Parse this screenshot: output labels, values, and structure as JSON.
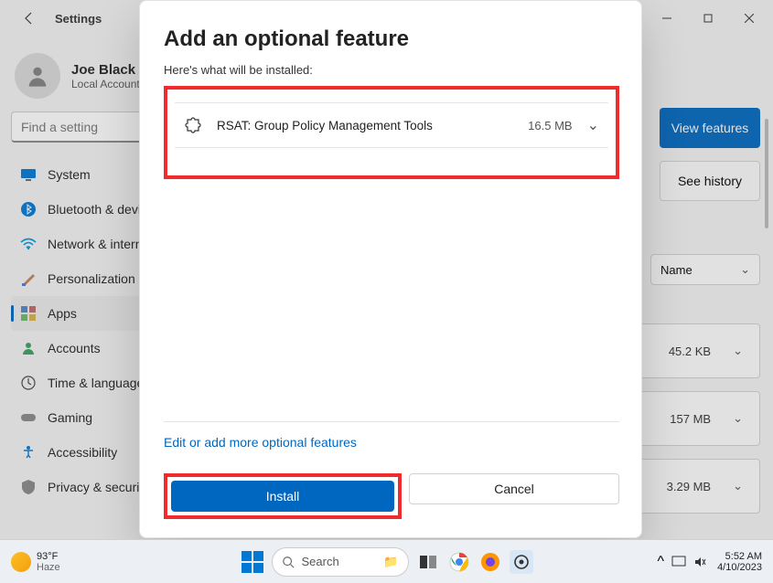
{
  "window": {
    "title": "Settings"
  },
  "profile": {
    "name": "Joe Black",
    "account_type": "Local Account"
  },
  "search": {
    "placeholder": "Find a setting"
  },
  "sidebar": {
    "items": [
      {
        "label": "System"
      },
      {
        "label": "Bluetooth & devices"
      },
      {
        "label": "Network & internet"
      },
      {
        "label": "Personalization"
      },
      {
        "label": "Apps"
      },
      {
        "label": "Accounts"
      },
      {
        "label": "Time & language"
      },
      {
        "label": "Gaming"
      },
      {
        "label": "Accessibility"
      },
      {
        "label": "Privacy & security"
      }
    ]
  },
  "page": {
    "view_features_btn": "View features",
    "see_history_btn": "See history",
    "sort_label": "Name",
    "rows": [
      {
        "size": "45.2 KB"
      },
      {
        "size": "157 MB"
      },
      {
        "size": "3.29 MB"
      }
    ]
  },
  "modal": {
    "title": "Add an optional feature",
    "subtitle": "Here's what will be installed:",
    "feature": {
      "name": "RSAT: Group Policy Management Tools",
      "size": "16.5 MB"
    },
    "edit_link": "Edit or add more optional features",
    "install_btn": "Install",
    "cancel_btn": "Cancel"
  },
  "taskbar": {
    "weather": {
      "temp": "93°F",
      "desc": "Haze"
    },
    "search_placeholder": "Search",
    "time": "5:52 AM",
    "date": "4/10/2023"
  }
}
